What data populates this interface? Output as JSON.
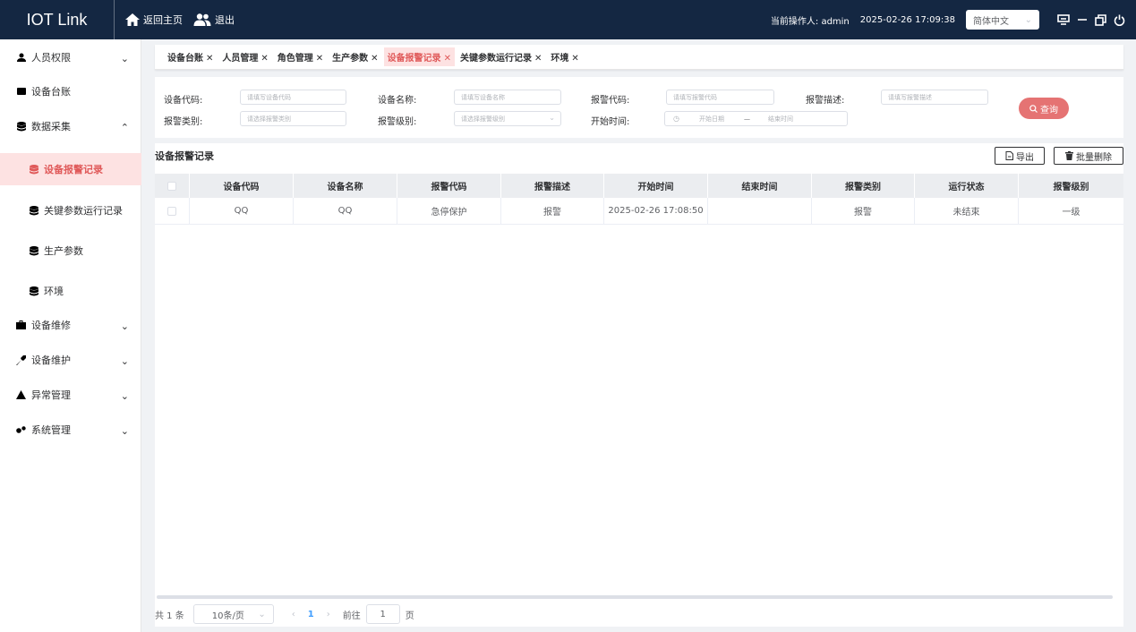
{
  "topbar": {
    "brand": "IOT Link",
    "home_label": "返回主页",
    "logout_label": "退出",
    "operator_label": "当前操作人: admin",
    "datetime": "2025-02-26 17:09:38",
    "language": "简体中文"
  },
  "sidebar": {
    "items": [
      {
        "label": "人员权限"
      },
      {
        "label": "设备台账"
      },
      {
        "label": "数据采集"
      },
      {
        "label": "设备报警记录"
      },
      {
        "label": "关键参数运行记录"
      },
      {
        "label": "生产参数"
      },
      {
        "label": "环境"
      },
      {
        "label": "设备维修"
      },
      {
        "label": "设备维护"
      },
      {
        "label": "异常管理"
      },
      {
        "label": "系统管理"
      }
    ]
  },
  "tabs": [
    {
      "label": "设备台账"
    },
    {
      "label": "人员管理"
    },
    {
      "label": "角色管理"
    },
    {
      "label": "生产参数"
    },
    {
      "label": "设备报警记录"
    },
    {
      "label": "关键参数运行记录"
    },
    {
      "label": "环境"
    }
  ],
  "search": {
    "device_code_label": "设备代码:",
    "device_code_placeholder": "请填写设备代码",
    "device_name_label": "设备名称:",
    "device_name_placeholder": "请填写设备名称",
    "alarm_code_label": "报警代码:",
    "alarm_code_placeholder": "请填写报警代码",
    "alarm_desc_label": "报警描述:",
    "alarm_desc_placeholder": "请填写报警描述",
    "alarm_type_label": "报警类别:",
    "alarm_type_placeholder": "请选择报警类别",
    "alarm_level_label": "报警级别:",
    "alarm_level_placeholder": "请选择报警级别",
    "start_time_label": "开始时间:",
    "start_date_placeholder": "开始日期",
    "range_sep": "—",
    "end_date_placeholder": "结束时间",
    "query_label": "查询"
  },
  "table": {
    "title": "设备报警记录",
    "export_label": "导出",
    "batch_delete_label": "批量删除",
    "columns": [
      "设备代码",
      "设备名称",
      "报警代码",
      "报警描述",
      "开始时间",
      "结束时间",
      "报警类别",
      "运行状态",
      "报警级别"
    ],
    "rows": [
      [
        "QQ",
        "QQ",
        "急停保护",
        "报警",
        "2025-02-26 17:08:50",
        "",
        "报警",
        "未结束",
        "一级"
      ]
    ]
  },
  "pager": {
    "total": "共 1 条",
    "page_size": "10条/页",
    "prev": "‹",
    "current": "1",
    "next": "›",
    "goto_label": "前往",
    "goto_value": "1",
    "page_unit": "页"
  }
}
